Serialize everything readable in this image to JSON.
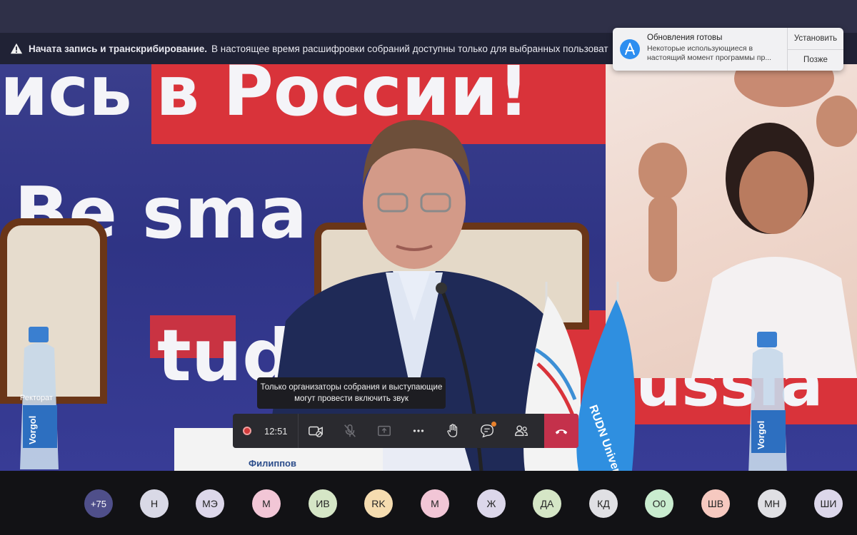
{
  "banner": {
    "bold_text": "Начата запись и транскрибирование.",
    "text": "В настоящее время расшифровки собраний доступны только для выбранных пользоват"
  },
  "notification": {
    "title": "Обновления готовы",
    "text": "Некоторые использующиеся в настоящий момент программы пр...",
    "install_label": "Установить",
    "later_label": "Позже"
  },
  "video": {
    "backdrop_text_line1": "ись в России!",
    "backdrop_text_line2": "Be sma",
    "backdrop_text_line3": "tudy",
    "backdrop_text_line4": "ussia",
    "left_label": "Ректорат",
    "nameplate": "Филиппов",
    "flag_text": "RUDN University",
    "bottle_text": "Vorgol"
  },
  "tooltip": {
    "text": "Только организаторы собрания и выступающие могут провести включить звук"
  },
  "toolbar": {
    "timer": "12:51"
  },
  "participants": [
    {
      "initials": "+75",
      "color": "#4f4f8a"
    },
    {
      "initials": "Н",
      "color": "#d9d9e6"
    },
    {
      "initials": "МЭ",
      "color": "#dcd7ea"
    },
    {
      "initials": "М",
      "color": "#f2c6d6"
    },
    {
      "initials": "ИВ",
      "color": "#d5e6c6"
    },
    {
      "initials": "RK",
      "color": "#f5dcb0"
    },
    {
      "initials": "М",
      "color": "#f2c6d6"
    },
    {
      "initials": "Ж",
      "color": "#dcd7ea"
    },
    {
      "initials": "ДА",
      "color": "#d5e6c6"
    },
    {
      "initials": "КД",
      "color": "#e0e0e4"
    },
    {
      "initials": "О0",
      "color": "#c9eccf"
    },
    {
      "initials": "ШВ",
      "color": "#f6c9c0"
    },
    {
      "initials": "МН",
      "color": "#e0e0e4"
    },
    {
      "initials": "ШИ",
      "color": "#dcd7ea"
    }
  ]
}
